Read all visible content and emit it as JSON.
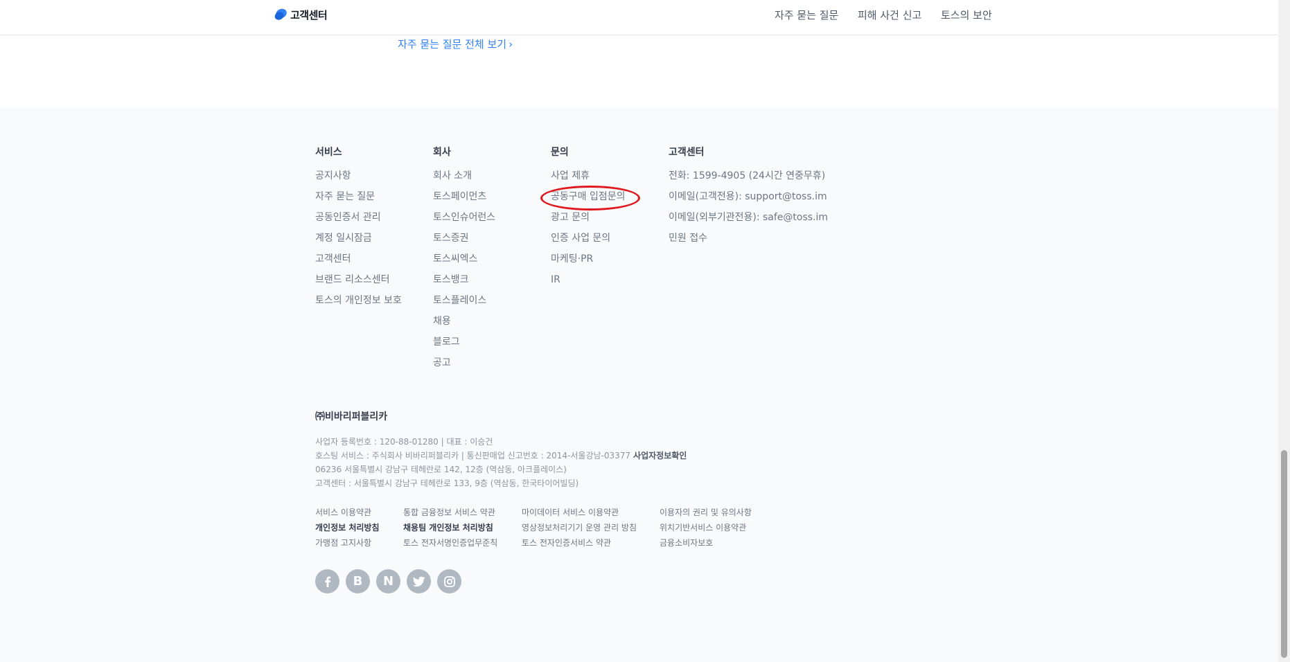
{
  "header": {
    "logo_text": "고객센터",
    "nav": [
      "자주 묻는 질문",
      "피해 사건 신고",
      "토스의 보안"
    ]
  },
  "faq_link": {
    "label": "자주 묻는 질문 전체 보기",
    "chevron": "›"
  },
  "footer": {
    "columns": {
      "service": {
        "title": "서비스",
        "items": [
          "공지사항",
          "자주 묻는 질문",
          "공동인증서 관리",
          "계정 일시잠금",
          "고객센터",
          "브랜드 리소스센터",
          "토스의 개인정보 보호"
        ]
      },
      "company": {
        "title": "회사",
        "items": [
          "회사 소개",
          "토스페이먼츠",
          "토스인슈어런스",
          "토스증권",
          "토스씨엑스",
          "토스뱅크",
          "토스플레이스",
          "채용",
          "블로그",
          "공고"
        ]
      },
      "inquiry": {
        "title": "문의",
        "items": [
          "사업 제휴",
          "공동구매 입점문의",
          "광고 문의",
          "인증 사업 문의",
          "마케팅·PR",
          "IR"
        ]
      },
      "cs": {
        "title": "고객센터",
        "items": [
          "전화: 1599-4905 (24시간 연중무휴)",
          "이메일(고객전용): support@toss.im",
          "이메일(외부기관전용): safe@toss.im",
          "민원 접수"
        ]
      }
    },
    "company_name": "㈜비바리퍼블리카",
    "company_info": {
      "line1": "사업자 등록번호 : 120-88-01280 | 대표 : 이승건",
      "line2": "호스팅 서비스 : 주식회사 비바리퍼블리카 | 통신판매업 신고번호 : 2014-서울강남-03377",
      "line2_link": "사업자정보확인",
      "line3": "06236 서울특별시 강남구 테헤란로 142, 12층 (역삼동, 아크플레이스)",
      "line4": "고객센터 : 서울특별시 강남구 테헤란로 133, 9층 (역삼동, 한국타이어빌딩)"
    },
    "policies": {
      "col1": [
        "서비스 이용약관",
        "개인정보 처리방침",
        "가맹점 고지사항"
      ],
      "col2": [
        "통합 금융정보 서비스 약관",
        "채용팀 개인정보 처리방침",
        "토스 전자서명인증업무준칙"
      ],
      "col3": [
        "마이데이터 서비스 이용약관",
        "영상정보처리기기 운영 관리 방침",
        "토스 전자인증서비스 약관"
      ],
      "col4": [
        "이용자의 권리 및 유의사항",
        "위치기반서비스 이용약관",
        "금융소비자보호"
      ]
    },
    "social": {
      "icons": [
        "facebook-icon",
        "blog-icon",
        "naver-icon",
        "twitter-icon",
        "instagram-icon"
      ],
      "blog_letter": "B",
      "naver_letter": "N"
    }
  },
  "colors": {
    "accent": "#3182f6",
    "footer_bg": "#f9fafb",
    "highlight": "#e0191f",
    "social_bg": "#b0b8c1"
  }
}
